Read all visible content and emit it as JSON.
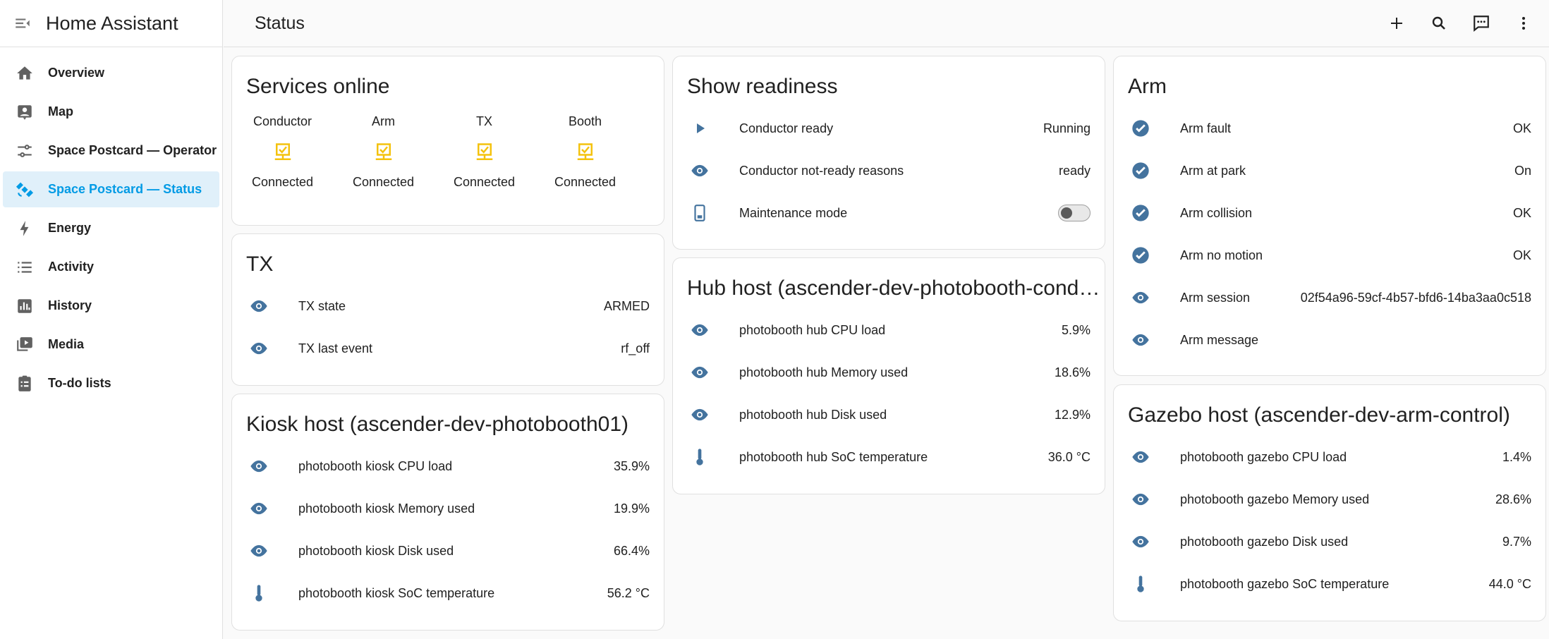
{
  "app": {
    "title": "Home Assistant"
  },
  "sidebar": {
    "items": [
      {
        "label": "Overview",
        "icon": "home-icon"
      },
      {
        "label": "Map",
        "icon": "map-icon"
      },
      {
        "label": "Space Postcard — Operator",
        "icon": "tune-icon"
      },
      {
        "label": "Space Postcard — Status",
        "icon": "satellite-icon",
        "active": true
      },
      {
        "label": "Energy",
        "icon": "lightning-icon"
      },
      {
        "label": "Activity",
        "icon": "list-icon"
      },
      {
        "label": "History",
        "icon": "chart-icon"
      },
      {
        "label": "Media",
        "icon": "media-icon"
      },
      {
        "label": "To-do lists",
        "icon": "clipboard-icon"
      }
    ]
  },
  "header": {
    "title": "Status"
  },
  "colors": {
    "accent": "#039be5",
    "icon": "#44739e",
    "warning": "#f4c20d"
  },
  "services": {
    "title": "Services online",
    "items": [
      {
        "name": "Conductor",
        "state": "Connected"
      },
      {
        "name": "Arm",
        "state": "Connected"
      },
      {
        "name": "TX",
        "state": "Connected"
      },
      {
        "name": "Booth",
        "state": "Connected"
      }
    ]
  },
  "tx": {
    "title": "TX",
    "rows": [
      {
        "name": "TX state",
        "value": "ARMED"
      },
      {
        "name": "TX last event",
        "value": "rf_off"
      }
    ]
  },
  "kiosk": {
    "title": "Kiosk host (ascender-dev-photobooth01)",
    "rows": [
      {
        "name": "photobooth kiosk CPU load",
        "value": "35.9%"
      },
      {
        "name": "photobooth kiosk Memory used",
        "value": "19.9%"
      },
      {
        "name": "photobooth kiosk Disk used",
        "value": "66.4%"
      },
      {
        "name": "photobooth kiosk SoC temperature",
        "value": "56.2 °C"
      }
    ]
  },
  "readiness": {
    "title": "Show readiness",
    "rows": [
      {
        "name": "Conductor ready",
        "value": "Running"
      },
      {
        "name": "Conductor not-ready reasons",
        "value": "ready"
      },
      {
        "name": "Maintenance mode",
        "value": ""
      }
    ]
  },
  "hub": {
    "title": "Hub host (ascender-dev-photobooth-cond…",
    "rows": [
      {
        "name": "photobooth hub CPU load",
        "value": "5.9%"
      },
      {
        "name": "photobooth hub Memory used",
        "value": "18.6%"
      },
      {
        "name": "photobooth hub Disk used",
        "value": "12.9%"
      },
      {
        "name": "photobooth hub SoC temperature",
        "value": "36.0 °C"
      }
    ]
  },
  "arm": {
    "title": "Arm",
    "rows": [
      {
        "name": "Arm fault",
        "value": "OK"
      },
      {
        "name": "Arm at park",
        "value": "On"
      },
      {
        "name": "Arm collision",
        "value": "OK"
      },
      {
        "name": "Arm no motion",
        "value": "OK"
      },
      {
        "name": "Arm session",
        "value": "02f54a96-59cf-4b57-bfd6-14ba3aa0c518"
      },
      {
        "name": "Arm message",
        "value": ""
      }
    ]
  },
  "gazebo": {
    "title": "Gazebo host (ascender-dev-arm-control)",
    "rows": [
      {
        "name": "photobooth gazebo CPU load",
        "value": "1.4%"
      },
      {
        "name": "photobooth gazebo Memory used",
        "value": "28.6%"
      },
      {
        "name": "photobooth gazebo Disk used",
        "value": "9.7%"
      },
      {
        "name": "photobooth gazebo SoC temperature",
        "value": "44.0 °C"
      }
    ]
  }
}
